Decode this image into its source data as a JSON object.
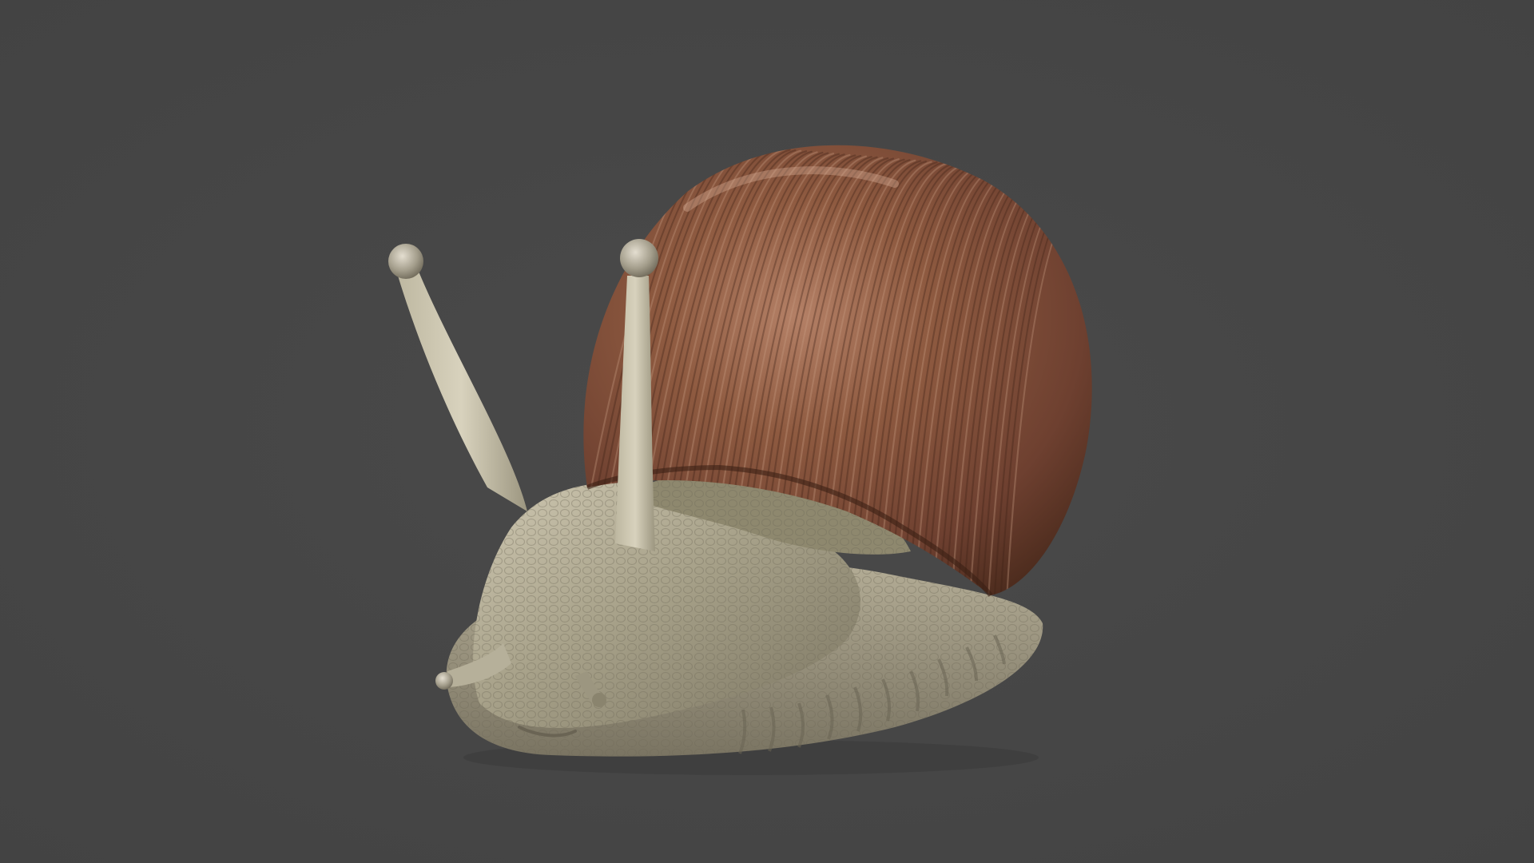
{
  "scene": {
    "subject": "snail",
    "background_color": "#464646",
    "colors": {
      "shell_base": "#7a4a32",
      "shell_highlight": "#b07a5e",
      "shell_dark": "#4a2a1c",
      "body_base": "#a09a82",
      "body_light": "#cfc8b2",
      "body_dark": "#6e6a58"
    }
  }
}
